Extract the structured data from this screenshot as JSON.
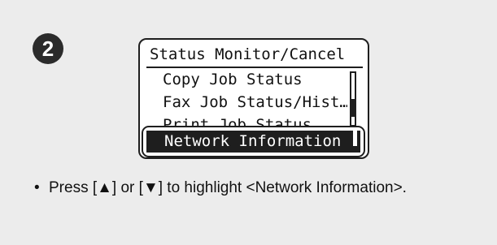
{
  "step": {
    "number": "2"
  },
  "lcd": {
    "title": "Status Monitor/Cancel",
    "items": [
      "Copy Job Status",
      "Fax Job Status/Hist…",
      "Print Job Status"
    ],
    "selected": "Network Information",
    "scrollbar": {
      "position_fraction": 0.75
    }
  },
  "instruction": {
    "bullet": "•",
    "text": "Press [▲] or [▼] to highlight <Network Information>."
  }
}
